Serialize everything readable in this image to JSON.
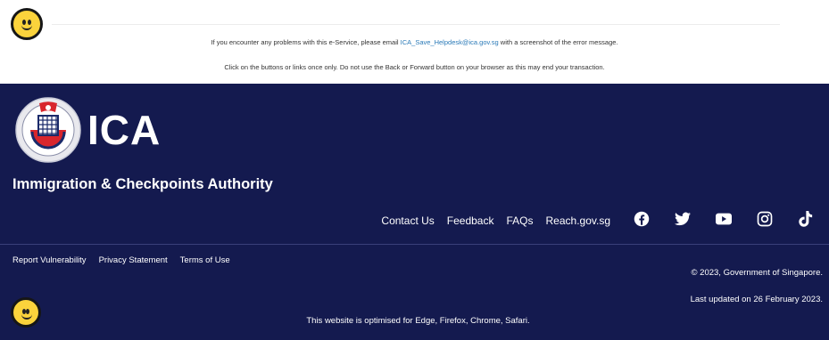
{
  "notices": {
    "line1_before": "If you encounter any problems with this e-Service, please email",
    "line1_email": "ICA_Save_Helpdesk@ica.gov.sg",
    "line1_after": "with a screenshot of the error message.",
    "line2": "Click on the buttons or links once only. Do not use the Back or Forward button on your browser as this may end your transaction."
  },
  "footer": {
    "logo_text": "ICA",
    "agency_name": "Immigration & Checkpoints Authority",
    "main_links": [
      "Contact Us",
      "Feedback",
      "FAQs",
      "Reach.gov.sg"
    ],
    "social_icons": [
      "facebook-icon",
      "twitter-icon",
      "youtube-icon",
      "instagram-icon",
      "tiktok-icon"
    ],
    "legal_links": [
      "Report Vulnerability",
      "Privacy Statement",
      "Terms of Use"
    ],
    "copyright": "© 2023, Government of Singapore.",
    "last_updated": "Last updated on 26 February 2023.",
    "optimised": "This website is optimised for Edge, Firefox, Chrome, Safari."
  },
  "colors": {
    "footer_bg": "#141a4f",
    "link_blue": "#2a7ab8",
    "emoji_yellow": "#fbd33c"
  }
}
